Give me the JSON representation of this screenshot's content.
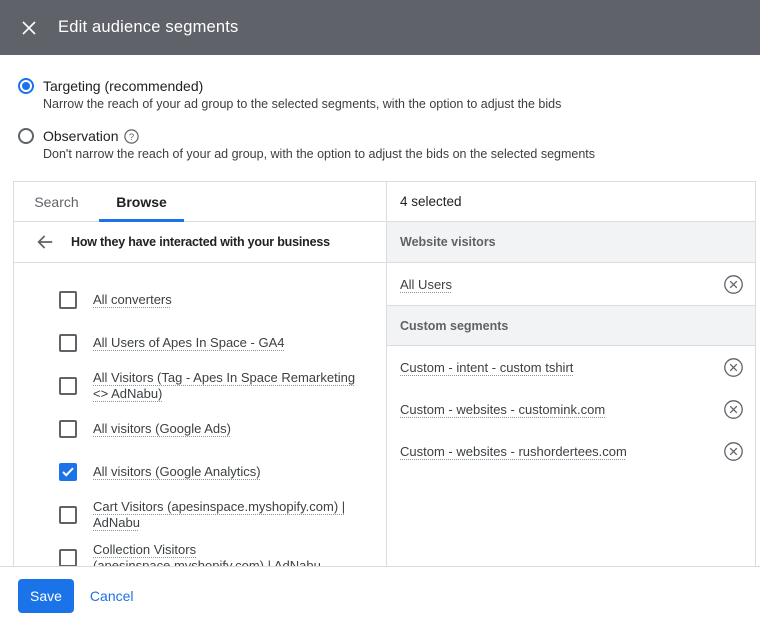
{
  "colors": {
    "accent": "#1a73e8",
    "header_bg": "#5f6369"
  },
  "header": {
    "title": "Edit audience segments"
  },
  "radio_options": [
    {
      "name": "radio-option-targeting",
      "label": "Targeting (recommended)",
      "description": "Narrow the reach of your ad group to the selected segments, with the option to adjust the bids",
      "selected": true,
      "help": false
    },
    {
      "name": "radio-option-observation",
      "label": "Observation",
      "description": "Don't narrow the reach of your ad group, with the option to adjust the bids on the selected segments",
      "selected": false,
      "help": true
    }
  ],
  "picker": {
    "tabs": [
      {
        "name": "tab-search",
        "label": "Search",
        "active": false
      },
      {
        "name": "tab-browse",
        "label": "Browse",
        "active": true
      }
    ],
    "breadcrumb": "How they have interacted with your business",
    "segments": [
      {
        "label": "All converters",
        "checked": false
      },
      {
        "label": "All Users of Apes In Space - GA4",
        "checked": false
      },
      {
        "label": "All Visitors (Tag - Apes In Space Remarketing <> AdNabu)",
        "checked": false
      },
      {
        "label": "All visitors (Google Ads)",
        "checked": false
      },
      {
        "label": "All visitors (Google Analytics)",
        "checked": true
      },
      {
        "label": "Cart Visitors (apesinspace.myshopify.com) | AdNabu",
        "checked": false
      },
      {
        "label": "Collection Visitors (apesinspace.myshopify.com) | AdNabu",
        "checked": false
      }
    ],
    "selected_panel": {
      "count_label": "4 selected",
      "groups": [
        {
          "header": "Website visitors",
          "items": [
            {
              "label": "All Users"
            }
          ]
        },
        {
          "header": "Custom segments",
          "items": [
            {
              "label": "Custom - intent - custom tshirt"
            },
            {
              "label": "Custom - websites - customink.com"
            },
            {
              "label": "Custom - websites - rushordertees.com"
            }
          ]
        }
      ]
    }
  },
  "footer": {
    "save_label": "Save",
    "cancel_label": "Cancel"
  }
}
